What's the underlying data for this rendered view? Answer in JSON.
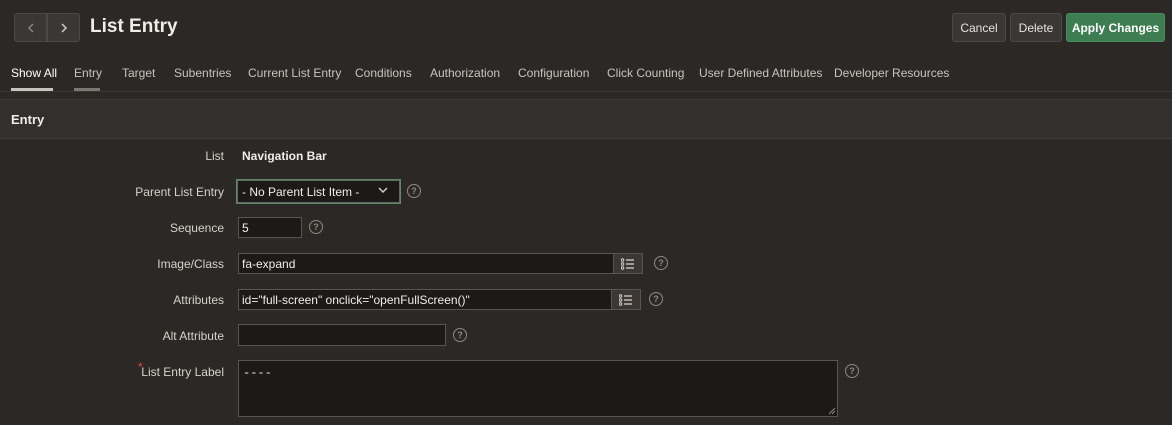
{
  "header": {
    "title": "List Entry",
    "prev_icon": "chevron-left-icon",
    "next_icon": "chevron-right-icon",
    "buttons": {
      "cancel": "Cancel",
      "delete": "Delete",
      "apply": "Apply Changes"
    },
    "apply_color": "#3d7d51"
  },
  "tabs": [
    {
      "label": "Show All",
      "active": true
    },
    {
      "label": "Entry"
    },
    {
      "label": "Target"
    },
    {
      "label": "Subentries"
    },
    {
      "label": "Current List Entry"
    },
    {
      "label": "Conditions"
    },
    {
      "label": "Authorization"
    },
    {
      "label": "Configuration"
    },
    {
      "label": "Click Counting"
    },
    {
      "label": "User Defined Attributes"
    },
    {
      "label": "Developer Resources"
    }
  ],
  "region": {
    "title": "Entry"
  },
  "form": {
    "list": {
      "label": "List",
      "value": "Navigation Bar"
    },
    "parent": {
      "label": "Parent List Entry",
      "value": "- No Parent List Item -"
    },
    "sequence": {
      "label": "Sequence",
      "value": "5"
    },
    "image_class": {
      "label": "Image/Class",
      "value": "fa-expand"
    },
    "attributes": {
      "label": "Attributes",
      "value": "id=\"full-screen\" onclick=\"openFullScreen()\""
    },
    "alt": {
      "label": "Alt Attribute",
      "value": ""
    },
    "entry_label": {
      "label": "List Entry Label",
      "value": "----",
      "required_mark": "*"
    },
    "help_glyph": "?"
  }
}
